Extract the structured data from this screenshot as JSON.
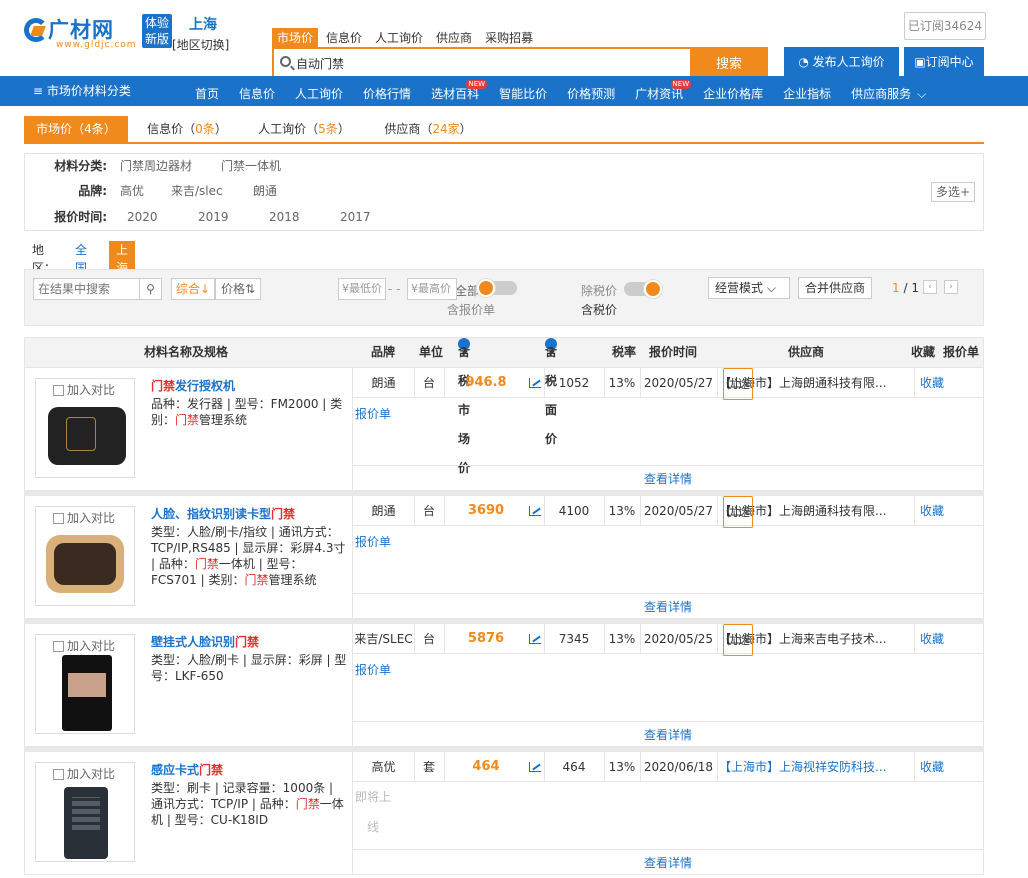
{
  "header": {
    "logo_text": "广材网",
    "logo_url": "www.gldjc.com",
    "badge_line1": "体验",
    "badge_line2": "新版",
    "city": "上海",
    "city_switch": "[地区切换]",
    "top_nav": [
      "市场价",
      "信息价",
      "人工询价",
      "供应商",
      "采购招募"
    ],
    "search_value": "自动门禁",
    "search_button": "搜索",
    "subscribed": "已订阅34624",
    "publish_button": "发布人工询价",
    "subscribe_button": "订阅中心"
  },
  "nav": {
    "category_menu": "≡ 市场价材料分类",
    "items": [
      "首页",
      "信息价",
      "人工询价",
      "价格行情",
      "选材百科",
      "智能比价",
      "价格预测",
      "广材资讯",
      "企业价格库",
      "企业指标",
      "供应商服务"
    ],
    "new_flags": [
      "选材百科",
      "广材资讯"
    ]
  },
  "tabs": [
    {
      "label": "市场价（",
      "count": "4条",
      "suffix": "）"
    },
    {
      "label": "信息价（",
      "count": "0条",
      "suffix": "）"
    },
    {
      "label": "人工询价（",
      "count": "5条",
      "suffix": "）"
    },
    {
      "label": "供应商（",
      "count": "24家",
      "suffix": "）"
    }
  ],
  "filters": {
    "category_label": "材料分类:",
    "categories": [
      "门禁周边器材",
      "门禁一体机"
    ],
    "brand_label": "品牌:",
    "brands": [
      "高优",
      "来吉/slec",
      "朗通"
    ],
    "multi": "多选+",
    "time_label": "报价时间:",
    "years": [
      "2020",
      "2019",
      "2018",
      "2017"
    ]
  },
  "region": {
    "label": "地区：",
    "options": [
      "全国",
      "上海"
    ]
  },
  "toolbar": {
    "search_placeholder": "在结果中搜索",
    "sort_default": "综合↓",
    "sort_price": "价格⇅",
    "min_price": "¥最低价",
    "dash": "- -",
    "max_price": "¥最高价",
    "all_label": "全部",
    "include_quote": "含报价单",
    "tax_excl": "除税价",
    "tax_incl": "含税价",
    "mode": "经营模式",
    "merge": "合并供应商",
    "page": "1 / 1"
  },
  "table_headers": {
    "name": "材料名称及规格",
    "brand": "品牌",
    "unit": "单位",
    "market_price": "含税市场价",
    "face_price": "含税面价",
    "tax": "税率",
    "time": "报价时间",
    "supplier": "供应商",
    "fav": "收藏",
    "quote": "报价单"
  },
  "rows": [
    {
      "compare": "加入对比",
      "title_hl": "门禁",
      "title_rest": "发行授权机",
      "desc_a": "品种：发行器 | 型号：FM2000 | 类别：",
      "desc_hl": "门禁",
      "desc_b": "管理系统",
      "brand": "朗通",
      "unit": "台",
      "price": "946.8",
      "face": "1052",
      "tax": "13%",
      "date": "2020/05/27",
      "supplier": "【上海市】上海朗通科技有限...",
      "youxuan": "优选",
      "fav": "收藏",
      "quote": "报价单",
      "detail": "查看详情"
    },
    {
      "compare": "加入对比",
      "title_pre": "人脸、指纹识别读卡型",
      "title_hl": "门禁",
      "desc_a": "类型：人脸/刷卡/指纹 | 通讯方式：TCP/IP,RS485 | 显示屏：彩屏4.3寸 | 品种：",
      "desc_hl": "门禁",
      "desc_b": "一体机 | 型号：FCS701 | 类别：",
      "desc_hl2": "门禁",
      "desc_c": "管理系统",
      "brand": "朗通",
      "unit": "台",
      "price": "3690",
      "face": "4100",
      "tax": "13%",
      "date": "2020/05/27",
      "supplier": "【上海市】上海朗通科技有限...",
      "youxuan": "优选",
      "fav": "收藏",
      "quote": "报价单",
      "detail": "查看详情"
    },
    {
      "compare": "加入对比",
      "title_pre": "壁挂式人脸识别",
      "title_hl": "门禁",
      "desc_a": "类型：人脸/刷卡 | 显示屏：彩屏 | 型号：LKF-650",
      "brand": "来吉/SLEC",
      "unit": "台",
      "price": "5876",
      "face": "7345",
      "tax": "13%",
      "date": "2020/05/25",
      "supplier": "【上海市】上海来吉电子技术...",
      "youxuan": "优选",
      "fav": "收藏",
      "quote": "报价单",
      "detail": "查看详情"
    },
    {
      "compare": "加入对比",
      "title_pre": "感应卡式",
      "title_hl": "门禁",
      "desc_a": "类型：刷卡 | 记录容量：1000条 | 通讯方式：TCP/IP | 品种：",
      "desc_hl": "门禁",
      "desc_b": "一体机 | 型号：CU-K18ID",
      "brand": "高优",
      "unit": "套",
      "price": "464",
      "face": "464",
      "tax": "13%",
      "date": "2020/06/18",
      "supplier": "【上海市】上海视祥安防科技...",
      "fav": "收藏",
      "quote_disabled_1": "即将上",
      "quote_disabled_2": "线",
      "detail": "查看详情"
    }
  ],
  "colors": {
    "brand_blue": "#1b73c9",
    "accent_orange": "#f08a1c",
    "highlight_red": "#e23030"
  }
}
